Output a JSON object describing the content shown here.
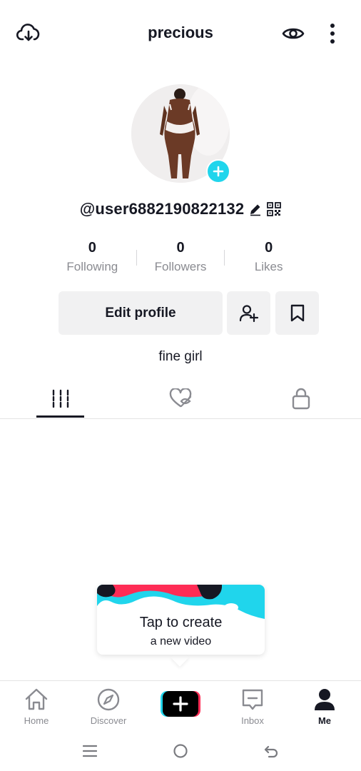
{
  "header": {
    "title": "precious",
    "icons": [
      "cloud-download-icon",
      "eye-icon",
      "more-vertical-icon"
    ]
  },
  "profile": {
    "username": "@user6882190822132",
    "bio": "fine girl",
    "stats": [
      {
        "value": "0",
        "label": "Following"
      },
      {
        "value": "0",
        "label": "Followers"
      },
      {
        "value": "0",
        "label": "Likes"
      }
    ],
    "edit_button_label": "Edit profile"
  },
  "tabs": {
    "items": [
      "grid-icon",
      "liked-heart-icon",
      "lock-icon"
    ],
    "active_index": 0
  },
  "tooltip": {
    "title": "Tap to create",
    "subtitle": "a new video"
  },
  "bottom_nav": {
    "items": [
      {
        "label": "Home",
        "icon": "home-icon"
      },
      {
        "label": "Discover",
        "icon": "compass-icon"
      },
      {
        "label": "",
        "icon": "create-plus-icon"
      },
      {
        "label": "Inbox",
        "icon": "inbox-icon"
      },
      {
        "label": "Me",
        "icon": "profile-icon"
      }
    ],
    "active": "Me"
  },
  "colors": {
    "accent_cyan": "#20d5ec",
    "accent_red": "#fe2c55",
    "text_primary": "#161823",
    "text_secondary": "#8a8b91",
    "button_bg": "#f1f1f2"
  }
}
